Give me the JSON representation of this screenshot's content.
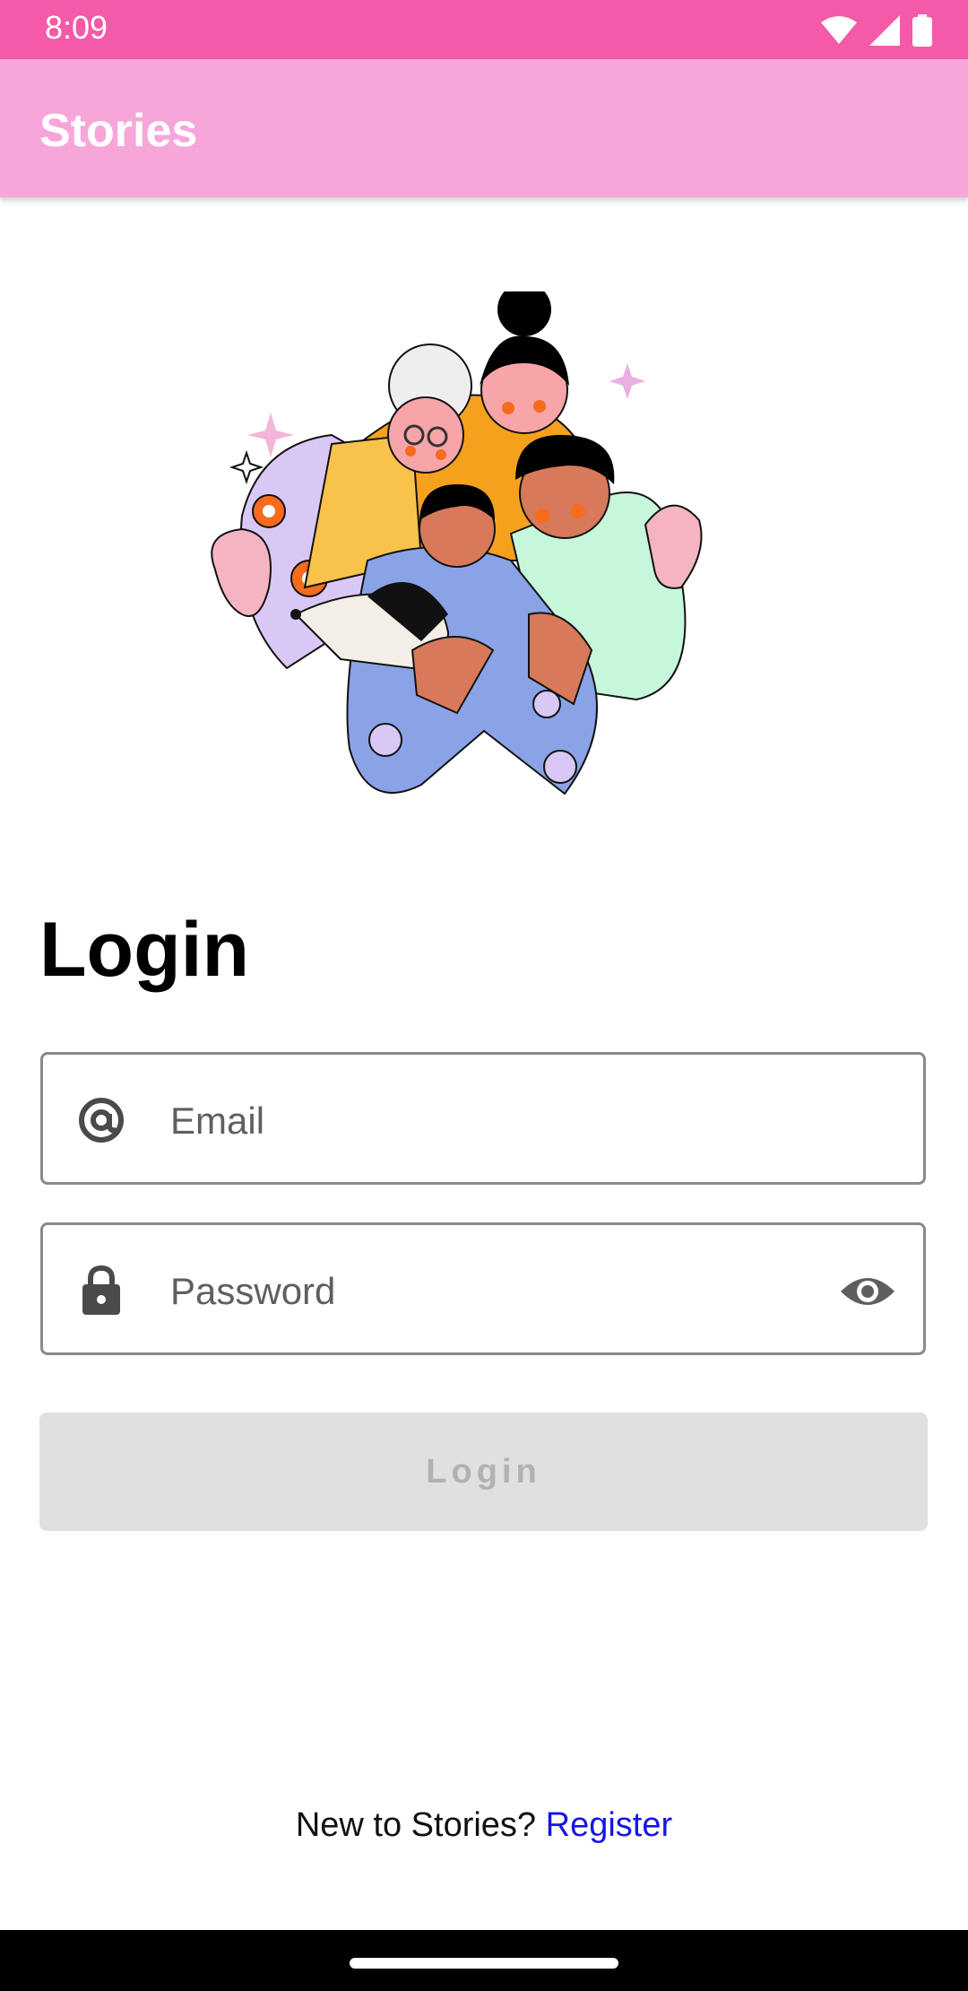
{
  "status_bar": {
    "time": "8:09",
    "icons": [
      "wifi-icon",
      "cellular-signal-icon",
      "battery-icon"
    ]
  },
  "app_bar": {
    "title": "Stories"
  },
  "illustration": {
    "description_icon": "family-hug-illustration"
  },
  "login_form": {
    "heading": "Login",
    "email": {
      "placeholder": "Email",
      "value": "",
      "icon": "at-sign-icon"
    },
    "password": {
      "placeholder": "Password",
      "value": "",
      "icon": "lock-icon",
      "toggle_icon": "eye-icon"
    },
    "submit_label": "Login",
    "submit_enabled": false
  },
  "footer": {
    "prompt": "New to Stories?",
    "link_label": "Register"
  },
  "colors": {
    "status_bar": "#F45AA8",
    "app_bar": "#F7A6DA",
    "link": "#1515E8",
    "button_disabled_bg": "#E0E0E0",
    "button_disabled_text": "#B2B2B2"
  }
}
